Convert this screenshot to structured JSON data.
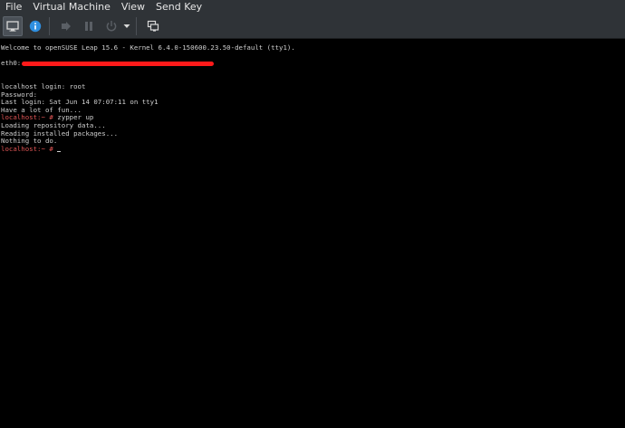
{
  "menubar": {
    "items": [
      "File",
      "Virtual Machine",
      "View",
      "Send Key"
    ]
  },
  "toolbar": {
    "buttons": [
      {
        "icon": "monitor-icon",
        "state": "active"
      },
      {
        "icon": "info-icon",
        "state": "enabled"
      },
      {
        "icon": "play-icon",
        "state": "disabled"
      },
      {
        "icon": "pause-icon",
        "state": "disabled"
      },
      {
        "icon": "power-icon",
        "state": "disabled"
      },
      {
        "icon": "chevron-down-icon",
        "state": "enabled"
      },
      {
        "icon": "snapshots-icon",
        "state": "enabled"
      }
    ],
    "colors": {
      "info": "#2f8fe0",
      "disabled": "#5a5f65",
      "enabled": "#d8d8d8"
    }
  },
  "console": {
    "welcome": "Welcome to openSUSE Leap 15.6 - Kernel 6.4.0-150600.23.50-default (tty1).",
    "eth_label": "eth0:",
    "login_line": "localhost login: root",
    "password_line": "Password:",
    "last_login": "Last login: Sat Jun 14 07:07:11 on tty1",
    "motd": "Have a lot of fun...",
    "prompt": "localhost:~ #",
    "command": " zypper up",
    "output": [
      "Loading repository data...",
      "Reading installed packages...",
      "Nothing to do."
    ],
    "prompt_color": "#e05555",
    "text_color": "#cfcfcf",
    "redaction_color": "#ff1a1a"
  }
}
